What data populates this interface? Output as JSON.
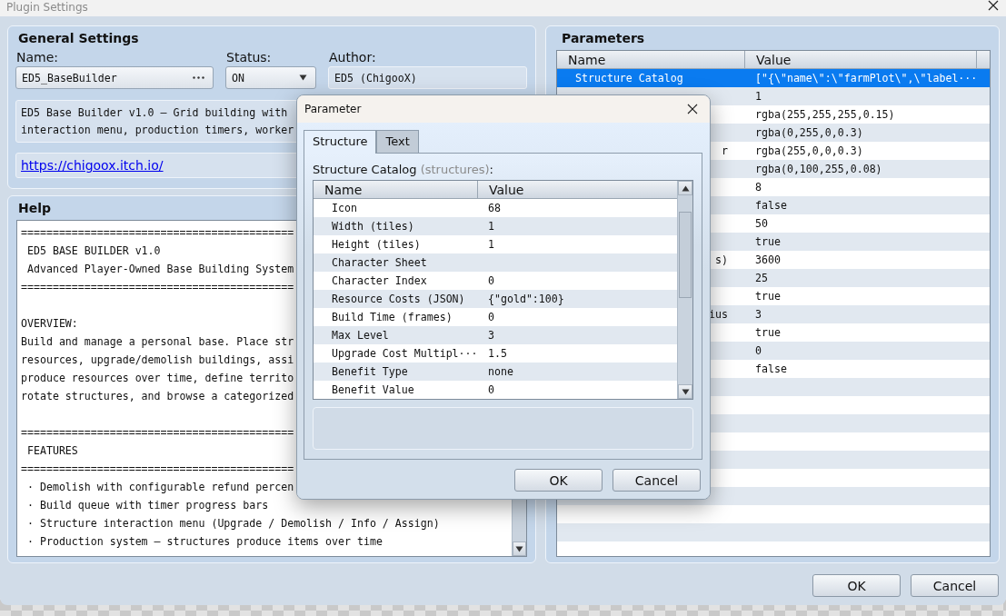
{
  "window": {
    "title": "Plugin Settings"
  },
  "general": {
    "heading": "General Settings",
    "name_label": "Name:",
    "name": "ED5_BaseBuilder",
    "status_label": "Status:",
    "status": "ON",
    "author_label": "Author:",
    "author": "ED5 (ChigooX)",
    "description": [
      "ED5 Base Builder v1.0 — Grid building with",
      "interaction menu, production timers, worker"
    ],
    "link": "https://chigoox.itch.io/"
  },
  "help": {
    "heading": "Help",
    "blocks": [
      [
        "===========================================",
        " ED5 BASE BUILDER v1.0",
        " Advanced Player-Owned Base Building System",
        "==========================================="
      ],
      [
        "OVERVIEW:",
        "Build and manage a personal base. Place str",
        "resources, upgrade/demolish buildings, assi",
        "produce resources over time, define territo",
        "rotate structures, and browse a categorized"
      ],
      [
        "===========================================",
        " FEATURES",
        "===========================================",
        " · Demolish with configurable refund percen",
        " · Build queue with timer progress bars",
        " · Structure interaction menu (Upgrade / Demolish / Info / Assign)",
        " · Production system — structures produce items over time"
      ]
    ]
  },
  "parameters": {
    "heading": "Parameters",
    "columns": [
      "Name",
      "Value"
    ],
    "rows": [
      {
        "name": "Structure Catalog",
        "value": "[\"{\\\"name\\\":\\\"farmPlot\\\",\\\"label···",
        "selected": true
      },
      {
        "value": "1",
        "selected": false
      },
      {
        "value": "rgba(255,255,255,0.15)",
        "selected": false
      },
      {
        "value": "rgba(0,255,0,0.3)",
        "selected": false
      },
      {
        "name_tail": "r",
        "value": "rgba(255,0,0,0.3)",
        "selected": false
      },
      {
        "value": "rgba(0,100,255,0.08)",
        "selected": false
      },
      {
        "value": "8",
        "selected": false
      },
      {
        "value": "false",
        "selected": false
      },
      {
        "value": "50",
        "selected": false
      },
      {
        "value": "true",
        "selected": false
      },
      {
        "name_tail": "s)",
        "value": "3600",
        "selected": false
      },
      {
        "value": "25",
        "selected": false
      },
      {
        "value": "true",
        "selected": false
      },
      {
        "name_tail": "ius",
        "value": "3",
        "selected": false
      },
      {
        "value": "true",
        "selected": false
      },
      {
        "value": "0",
        "selected": false
      },
      {
        "value": "false",
        "selected": false
      }
    ]
  },
  "buttons": [
    "OK",
    "Cancel"
  ],
  "dialog": {
    "title": "Parameter",
    "tabs": [
      {
        "label": "Structure",
        "selected": true
      },
      {
        "label": "Text",
        "selected": false
      }
    ],
    "label": "Structure Catalog",
    "hint": "(structures)",
    "label_end": ":",
    "columns": [
      "Name",
      "Value"
    ],
    "rows": [
      {
        "name": "Icon",
        "value": "68"
      },
      {
        "name": "Width (tiles)",
        "value": "1"
      },
      {
        "name": "Height (tiles)",
        "value": "1"
      },
      {
        "name": "Character Sheet"
      },
      {
        "name": "Character Index",
        "value": "0"
      },
      {
        "name": "Resource Costs (JSON)",
        "value": "{\"gold\":100}"
      },
      {
        "name": "Build Time (frames)",
        "value": "0"
      },
      {
        "name": "Max Level",
        "value": "3"
      },
      {
        "name": "Upgrade Cost Multipl···",
        "value": "1.5"
      },
      {
        "name": "Benefit Type",
        "value": "none"
      },
      {
        "name": "Benefit Value",
        "value": "0"
      }
    ],
    "buttons": [
      "OK",
      "Cancel"
    ]
  }
}
